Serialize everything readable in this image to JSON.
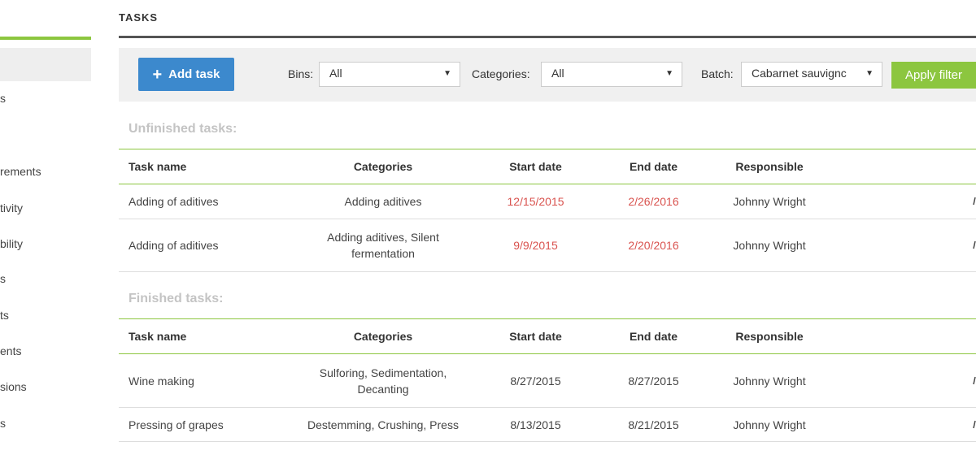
{
  "sidebar": {
    "items": [
      {
        "label": "s"
      },
      {
        "label": "rements"
      },
      {
        "label": "tivity"
      },
      {
        "label": "bility"
      },
      {
        "label": "s"
      },
      {
        "label": "ts"
      },
      {
        "label": "ents"
      },
      {
        "label": "sions"
      },
      {
        "label": "s"
      }
    ]
  },
  "page": {
    "title": "TASKS"
  },
  "filters": {
    "add_task_label": "Add task",
    "bins_label": "Bins:",
    "bins_value": "All",
    "categories_label": "Categories:",
    "categories_value": "All",
    "batch_label": "Batch:",
    "batch_value": "Cabarnet sauvignc",
    "apply_label": "Apply filter"
  },
  "columns": {
    "name": "Task name",
    "categories": "Categories",
    "start": "Start date",
    "end": "End date",
    "responsible": "Responsible"
  },
  "unfinished": {
    "heading": "Unfinished tasks:",
    "rows": [
      {
        "name": "Adding of aditives",
        "categories": "Adding aditives",
        "start": "12/15/2015",
        "end": "2/26/2016",
        "responsible": "Johnny Wright"
      },
      {
        "name": "Adding of aditives",
        "categories": "Adding aditives, Silent fermentation",
        "start": "9/9/2015",
        "end": "2/20/2016",
        "responsible": "Johnny Wright"
      }
    ]
  },
  "finished": {
    "heading": "Finished tasks:",
    "rows": [
      {
        "name": "Wine making",
        "categories": "Sulforing, Sedimentation, Decanting",
        "start": "8/27/2015",
        "end": "8/27/2015",
        "responsible": "Johnny Wright"
      },
      {
        "name": "Pressing of grapes",
        "categories": "Destemming, Crushing, Press",
        "start": "8/13/2015",
        "end": "8/21/2015",
        "responsible": "Johnny Wright"
      }
    ]
  },
  "colors": {
    "accent_green": "#8cc63f",
    "primary_blue": "#3c89cd",
    "overdue_red": "#d9534f",
    "heading_grey": "#c4c4c4"
  },
  "icons": {
    "add": "plus-icon",
    "dropdown": "caret-down-icon",
    "row_action": "edit-icon"
  }
}
